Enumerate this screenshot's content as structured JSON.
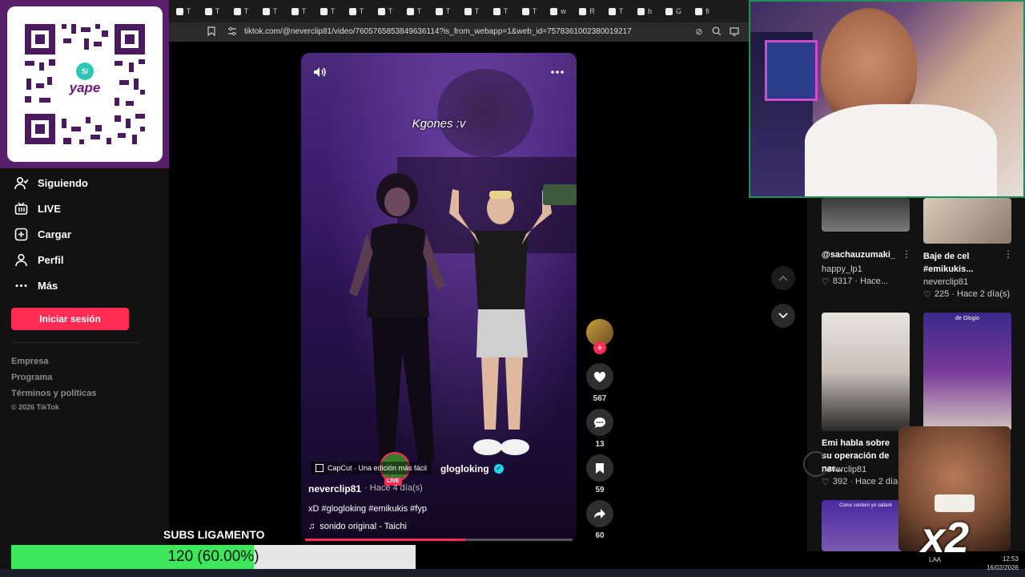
{
  "browser": {
    "url": "tiktok.com/@neverclip81/video/7605765853849636114?is_from_webapp=1&web_id=7578361002380019217",
    "tabs": [
      "T",
      "T",
      "T",
      "T",
      "T",
      "T",
      "T",
      "T",
      "T",
      "T",
      "T",
      "T",
      "T",
      "w",
      "R",
      "T",
      "b",
      "G",
      "fi"
    ]
  },
  "qr": {
    "brand": "yape",
    "brand_badge": "S/"
  },
  "sidebar": {
    "items": [
      {
        "label": "Siguiendo",
        "icon": "following-icon"
      },
      {
        "label": "LIVE",
        "icon": "live-icon"
      },
      {
        "label": "Cargar",
        "icon": "upload-icon"
      },
      {
        "label": "Perfil",
        "icon": "profile-icon"
      },
      {
        "label": "Más",
        "icon": "more-icon"
      }
    ],
    "login_button": "Iniciar sesión",
    "footer_links": [
      "Empresa",
      "Programa",
      "Términos y políticas"
    ],
    "copyright": "© 2026 TikTok"
  },
  "video": {
    "caption_overlay": "Kgones :v",
    "live_badge": "LIVE",
    "live_username": "glogloking",
    "capcut_tag": "CapCut · Una edición más fácil",
    "author": "neverclip81",
    "posted": "· Hace 4 día(s)",
    "description": "xD #glogloking #emikukis #fyp",
    "sound": "sonido original - Taichi",
    "progress": 0.6,
    "likes": "567",
    "comments": "13",
    "saves": "59",
    "shares": "60"
  },
  "feed": {
    "cards": [
      {
        "title": "@sachauzumaki_",
        "user": "happy_lp1",
        "meta": "8317 · Hace..."
      },
      {
        "title": "Baje de cel #emikukis...",
        "user": "neverclip81",
        "meta": "225 · Hace 2 día(s)"
      },
      {
        "title": "Emi habla sobre su operación de nar...",
        "user": "neverclip81",
        "meta": "392 · Hace 2 día"
      },
      {
        "title": "",
        "user": "",
        "meta": ""
      }
    ],
    "thumb_captions": [
      "de Glogio",
      "Como cordero yo saltaré"
    ]
  },
  "overlay": {
    "subs_title": "SUBS LIGAMENTO",
    "subs_text": "120 (60.00%)",
    "subs_progress": 0.6,
    "multiplier": "x2"
  },
  "taskbar": {
    "time": "12:53",
    "date": "16/02/2026",
    "lang": "LAA"
  },
  "colors": {
    "accent": "#fe2c55",
    "subs_green": "#3de65a",
    "qr_frame": "#5a1f6b"
  }
}
